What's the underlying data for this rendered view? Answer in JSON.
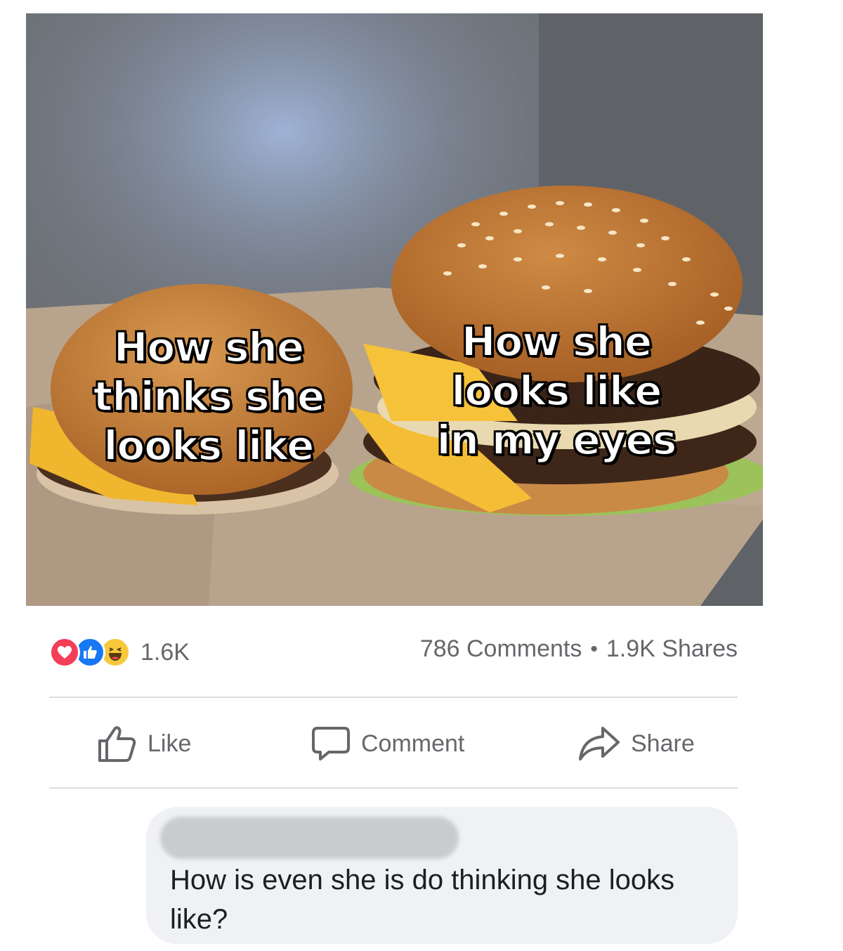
{
  "meme": {
    "caption_left": [
      "How she",
      "thinks she",
      "looks like"
    ],
    "caption_right": [
      "How she",
      "looks like",
      "in my eyes"
    ]
  },
  "reactions": {
    "icons": [
      "love-icon",
      "like-icon",
      "haha-icon"
    ],
    "count": "1.6K"
  },
  "stats": {
    "comments": "786 Comments",
    "separator": "•",
    "shares": "1.9K Shares"
  },
  "actions": {
    "like_label": "Like",
    "comment_label": "Comment",
    "share_label": "Share"
  },
  "comment": {
    "text": "How is even she is do thinking she looks like?"
  },
  "colors": {
    "love": "#f33e58",
    "like": "#1877f2",
    "haha": "#f7c83c",
    "secondary_text": "#65676b",
    "bubble": "#eff1f4"
  }
}
